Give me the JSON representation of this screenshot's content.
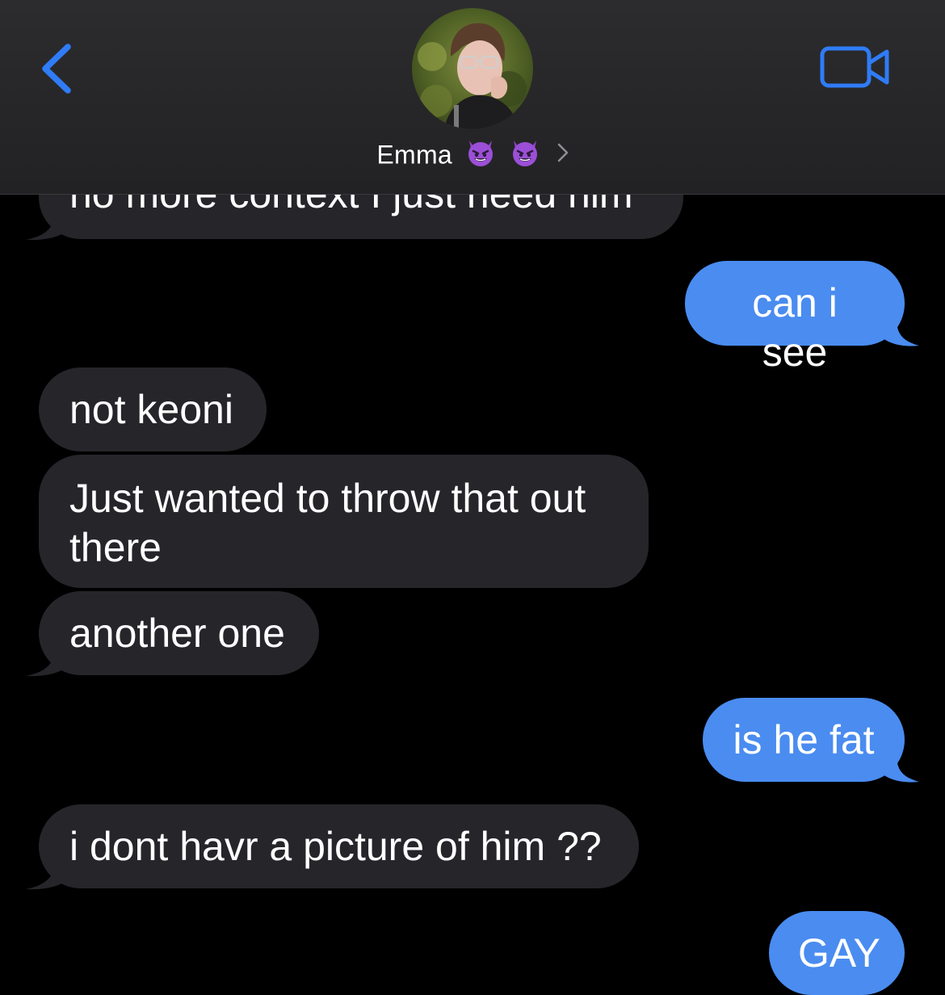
{
  "header": {
    "contact_name": "Emma",
    "contact_emojis": [
      "smiling-imp",
      "smiling-imp"
    ],
    "accent_color": "#2f7cf6"
  },
  "messages": [
    {
      "id": "m0",
      "side": "incoming",
      "text": "no more context I just need him"
    },
    {
      "id": "m1",
      "side": "outgoing",
      "text": "can i see"
    },
    {
      "id": "m2",
      "side": "incoming",
      "text": "not keoni"
    },
    {
      "id": "m3",
      "side": "incoming",
      "lines": [
        "Just wanted to throw that out",
        "there"
      ]
    },
    {
      "id": "m4",
      "side": "incoming",
      "text": "another one"
    },
    {
      "id": "m5",
      "side": "outgoing",
      "text": "is he fat"
    },
    {
      "id": "m6",
      "side": "incoming",
      "text": "i dont havr a picture of him ??"
    },
    {
      "id": "m7",
      "side": "outgoing",
      "text": "GAY"
    }
  ],
  "colors": {
    "incoming_bubble": "#26252a",
    "outgoing_bubble": "#4a8cf0",
    "background": "#000000",
    "header_bg": "#2c2c2e"
  }
}
